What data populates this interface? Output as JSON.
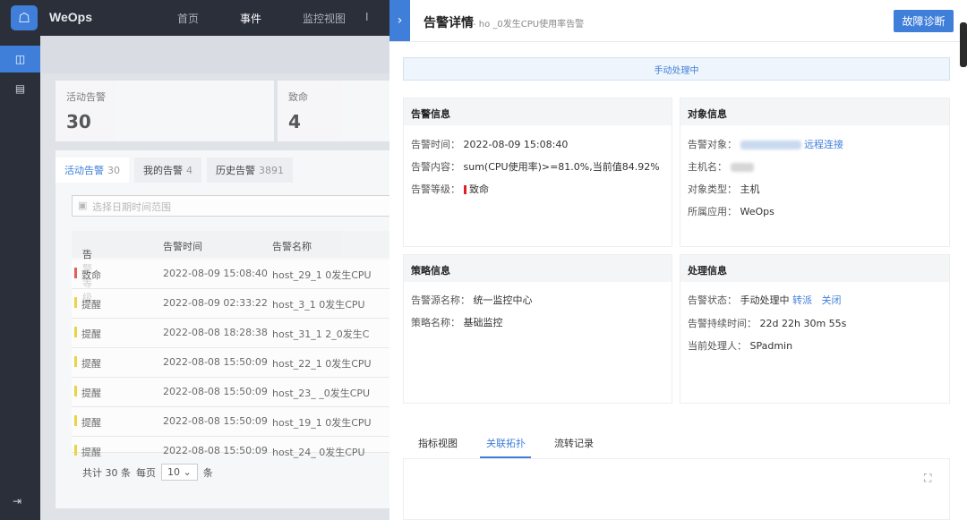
{
  "app": {
    "brand": "WeOps"
  },
  "nav": [
    "首页",
    "事件",
    "监控视图",
    "I"
  ],
  "stats": [
    {
      "label": "活动告警",
      "value": "30"
    },
    {
      "label": "致命",
      "value": "4"
    }
  ],
  "tabs": [
    {
      "label": "活动告警",
      "count": "30"
    },
    {
      "label": "我的告警",
      "count": "4"
    },
    {
      "label": "历史告警",
      "count": "3891"
    }
  ],
  "filter": {
    "placeholder": "选择日期时间范围"
  },
  "table": {
    "headers": [
      "告警等级",
      "告警时间",
      "告警名称"
    ],
    "rows": [
      {
        "level": "致命",
        "level_color": "#e02020",
        "time": "2022-08-09 15:08:40",
        "name": "host_29_1        0发生CPU"
      },
      {
        "level": "提醒",
        "level_color": "#e6c700",
        "time": "2022-08-09 02:33:22",
        "name": "host_3_1           0发生CPU"
      },
      {
        "level": "提醒",
        "level_color": "#e6c700",
        "time": "2022-08-08 18:28:38",
        "name": "host_31_1          2_0发生C"
      },
      {
        "level": "提醒",
        "level_color": "#e6c700",
        "time": "2022-08-08 15:50:09",
        "name": "host_22_1         0发生CPU"
      },
      {
        "level": "提醒",
        "level_color": "#e6c700",
        "time": "2022-08-08 15:50:09",
        "name": "host_23_          _0发生CPU"
      },
      {
        "level": "提醒",
        "level_color": "#e6c700",
        "time": "2022-08-08 15:50:09",
        "name": "host_19_1         0发生CPU"
      },
      {
        "level": "提醒",
        "level_color": "#e6c700",
        "time": "2022-08-08 15:50:09",
        "name": "host_24_          0发生CPU"
      }
    ]
  },
  "pager": {
    "total": "共计 30 条",
    "per_page_label": "每页",
    "per_page": "10",
    "unit": "条"
  },
  "drawer": {
    "title": "告警详情",
    "subtitle": "- ho                    _0发生CPU使用率告警",
    "diag_button": "故障诊断",
    "status_banner": "手动处理中",
    "alert_info": {
      "heading": "告警信息",
      "time_label": "告警时间：",
      "time": "2022-08-09 15:08:40",
      "content_label": "告警内容：",
      "content": "sum(CPU使用率)>=81.0%,当前值84.92%",
      "level_label": "告警等级：",
      "level": "致命"
    },
    "object_info": {
      "heading": "对象信息",
      "target_label": "告警对象：",
      "remote_link": "远程连接",
      "host_label": "主机名：",
      "type_label": "对象类型：",
      "type": "主机",
      "app_label": "所属应用：",
      "app": "WeOps"
    },
    "strategy_info": {
      "heading": "策略信息",
      "source_label": "告警源名称：",
      "source": "统一监控中心",
      "strategy_label": "策略名称：",
      "strategy": "基础监控"
    },
    "handle_info": {
      "heading": "处理信息",
      "status_label": "告警状态：",
      "status": "手动处理中",
      "transfer": "转派",
      "close": "关闭",
      "duration_label": "告警持续时间：",
      "duration": "22d 22h 30m 55s",
      "handler_label": "当前处理人：",
      "handler": "SPadmin"
    },
    "bottom_tabs": [
      "指标视图",
      "关联拓扑",
      "流转记录"
    ]
  }
}
